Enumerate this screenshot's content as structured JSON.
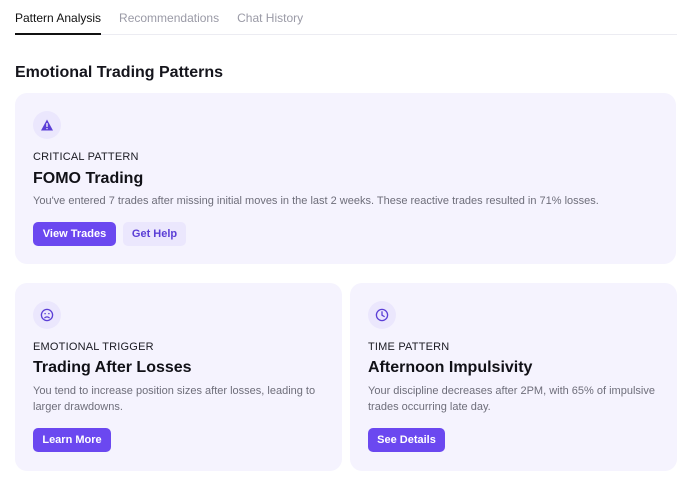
{
  "tabs": [
    {
      "label": "Pattern Analysis",
      "active": true
    },
    {
      "label": "Recommendations",
      "active": false
    },
    {
      "label": "Chat History",
      "active": false
    }
  ],
  "section_title": "Emotional Trading Patterns",
  "colors": {
    "accent": "#6b48f0",
    "card_bg": "#f5f3fe",
    "icon_bg": "#ebe7fd"
  },
  "cards": [
    {
      "icon": "warning-icon",
      "eyebrow": "CRITICAL PATTERN",
      "title": "FOMO Trading",
      "description": "You've entered 7 trades after missing initial moves in the last 2 weeks. These reactive trades resulted in 71% losses.",
      "primary_button": "View Trades",
      "secondary_button": "Get Help"
    },
    {
      "icon": "frown-icon",
      "eyebrow": "EMOTIONAL TRIGGER",
      "title": "Trading After Losses",
      "description": "You tend to increase position sizes after losses, leading to larger drawdowns.",
      "primary_button": "Learn More"
    },
    {
      "icon": "clock-icon",
      "eyebrow": "TIME PATTERN",
      "title": "Afternoon Impulsivity",
      "description": "Your discipline decreases after 2PM, with 65% of impulsive trades occurring late day.",
      "primary_button": "See Details"
    }
  ]
}
